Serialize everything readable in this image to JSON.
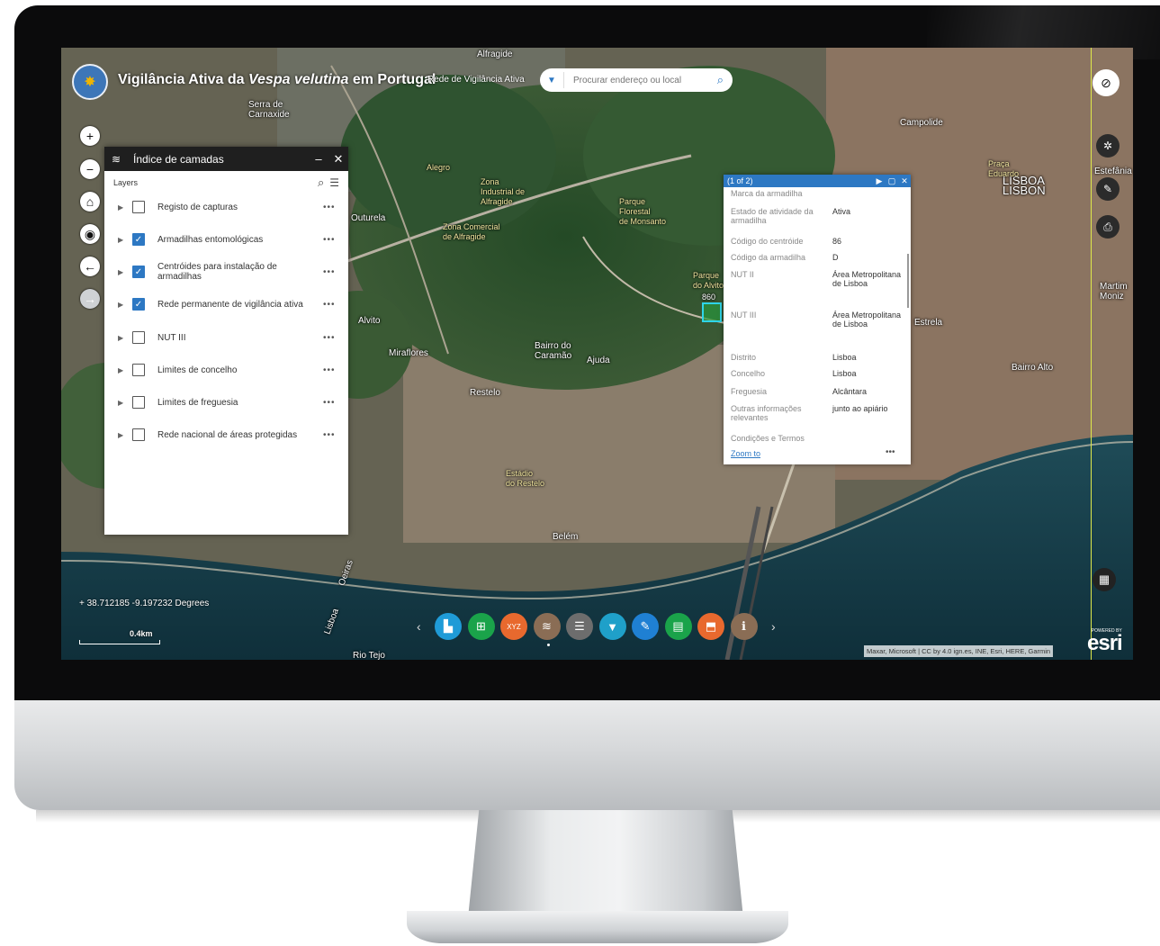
{
  "app": {
    "title_part1": "Vigilância Ativa da ",
    "title_italic": "Vespa velutina",
    "title_part2": " em Portugal",
    "subtitle_link": "Rede de Vigilância Ativa",
    "search_placeholder": "Procurar endereço ou local"
  },
  "colors": {
    "accent": "#2d78c3",
    "panel_header": "#1f1f1f"
  },
  "map_labels": [
    "Alfragide",
    "Serra de\nCarnaxide",
    "Campolide",
    "LISBOA\nLISBON",
    "Estefânia",
    "Outurela",
    "Zona Comercial\nde Alfragide",
    "Zona\nIndustrial de\nAlfragide",
    "Alegro",
    "Parque\nFlorestal\nde Monsanto",
    "Parque\ndo Alvito",
    "Alvito",
    "Miraflores",
    "Bairro do\nCaramão",
    "Ajuda",
    "Restelo",
    "Estrela",
    "Bairro Alto",
    "Martim\nMoniz",
    "Belém",
    "Estádio\ndo Restelo",
    "Oeiras",
    "Lisboa",
    "Rio Tejo",
    "Praça\nEduardo"
  ],
  "map_controls": {
    "zoom_in": "+",
    "zoom_out": "−",
    "home": "⌂",
    "locate": "◉",
    "back": "←",
    "forward": "→"
  },
  "layer_list": {
    "title": "Índice de camadas",
    "minimize": "–",
    "close": "✕",
    "section_label": "Layers",
    "items": [
      {
        "name": "Registo de capturas",
        "checked": false
      },
      {
        "name": "Armadilhas entomológicas",
        "checked": true
      },
      {
        "name": "Centróides para instalação de armadilhas",
        "checked": true
      },
      {
        "name": "Rede permanente de vigilância ativa",
        "checked": true
      },
      {
        "name": "NUT III",
        "checked": false
      },
      {
        "name": "Limites de concelho",
        "checked": false
      },
      {
        "name": "Limites de freguesia",
        "checked": false
      },
      {
        "name": "Rede nacional de áreas protegidas",
        "checked": false
      }
    ],
    "more": "•••"
  },
  "popup": {
    "count": "(1 of 2)",
    "fields": [
      {
        "k": "Marca da armadilha",
        "v": ""
      },
      {
        "k": "Estado de atividade da armadilha",
        "v": "Ativa"
      },
      {
        "k": "Código do centróide",
        "v": "86"
      },
      {
        "k": "Código da armadilha",
        "v": "D"
      },
      {
        "k": "NUT II",
        "v": "Área Metropolitana de Lisboa"
      },
      {
        "k": "NUT III",
        "v": "Área Metropolitana de Lisboa"
      },
      {
        "k": "Distrito",
        "v": "Lisboa"
      },
      {
        "k": "Concelho",
        "v": "Lisboa"
      },
      {
        "k": "Freguesia",
        "v": "Alcântara"
      },
      {
        "k": "Outras informações relevantes",
        "v": "junto ao apiário"
      },
      {
        "k": "Condições e Termos",
        "v": ""
      }
    ],
    "zoom_link": "Zoom to",
    "more": "•••"
  },
  "marker_label": "860",
  "coordinates": "38.712185 -9.197232 Degrees",
  "scale_label": "0.4km",
  "attribution": "Maxar, Microsoft | CC by 4.0 ign.es, INE, Esri, HERE, Garmin",
  "esri": {
    "powered_by": "POWERED BY",
    "logo": "esri"
  },
  "dock": [
    {
      "name": "basemap-gallery",
      "color": "#1f9bd7",
      "glyph": "▙"
    },
    {
      "name": "add-data",
      "color": "#1aa34a",
      "glyph": "⊞"
    },
    {
      "name": "coordinate-conversion",
      "color": "#e8692e",
      "glyph": "XYZ"
    },
    {
      "name": "layer-list",
      "color": "#8a6d55",
      "glyph": "≋"
    },
    {
      "name": "legend",
      "color": "#6d6d6d",
      "glyph": "☰"
    },
    {
      "name": "filter",
      "color": "#1fa0c9",
      "glyph": "▼"
    },
    {
      "name": "edit",
      "color": "#1f80d3",
      "glyph": "✎"
    },
    {
      "name": "attribute-table",
      "color": "#1aa34a",
      "glyph": "▤"
    },
    {
      "name": "print",
      "color": "#e8692e",
      "glyph": "⬒"
    },
    {
      "name": "about",
      "color": "#8a6d55",
      "glyph": "ℹ"
    }
  ]
}
